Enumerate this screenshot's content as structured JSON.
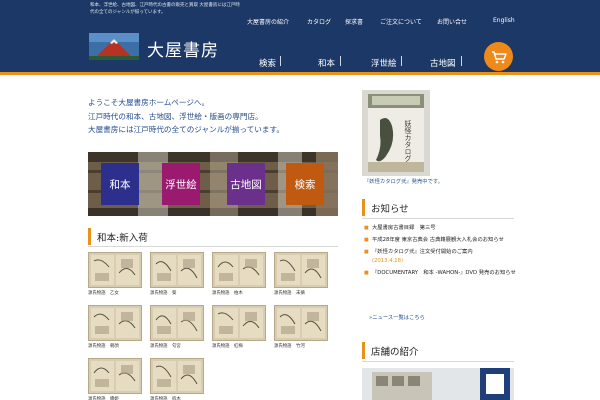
{
  "header": {
    "tagline": "和本、浮世絵、古地図、江戸時代の古書の販売と買取 大屋書房には江戸時代の全てのジャンルが揃っています。",
    "logo_text": "大屋書房",
    "top_nav": [
      "大屋書房の紹介",
      "カタログ",
      "探求書",
      "ご注文について",
      "お問い合せ",
      "English"
    ],
    "main_nav": [
      "検索",
      "和本",
      "浮世絵",
      "古地図"
    ],
    "cart_icon": "cart-icon"
  },
  "intro": {
    "lines": [
      "ようこそ大屋書房ホームページへ。",
      "江戸時代の和本、古地図、浮世絵・版画の専門店。",
      "大屋書房には江戸時代の全てのジャンルが揃っています。"
    ]
  },
  "categories": [
    {
      "label": "和本",
      "color": "#2c2f8c"
    },
    {
      "label": "浮世絵",
      "color": "#9a1a70"
    },
    {
      "label": "古地図",
      "color": "#6b2f8c"
    },
    {
      "label": "検索",
      "color": "#c05a10"
    }
  ],
  "new_arrivals": {
    "title": "和本:新入荷",
    "books": [
      {
        "caption": "源氏物語　乙女"
      },
      {
        "caption": "源氏物語　葵"
      },
      {
        "caption": "源氏物語　柏木"
      },
      {
        "caption": "源氏物語　末摘"
      },
      {
        "caption": "源氏物語　朝顔"
      },
      {
        "caption": "源氏物語　匂宮"
      },
      {
        "caption": "源氏物語　紅梅"
      },
      {
        "caption": "源氏物語　竹河"
      },
      {
        "caption": "源氏物語　橋姫"
      },
      {
        "caption": "源氏物語　宿木"
      }
    ]
  },
  "sidebar": {
    "catalog_caption": "『妖怪カタログ弐』発売中です。",
    "news_title": "お知らせ",
    "news": [
      {
        "text": "大屋書房古書目録　第三号",
        "date": ""
      },
      {
        "text": "平成28年度 東京古典会 古典籍展観大入札会のお知らせ",
        "date": ""
      },
      {
        "text": "『妖怪カタログ弐』注文受付開始のご案内",
        "date": "(2013.4.18)"
      },
      {
        "text": "『DOCUMENTARY　和本 -WAHON-』DVD 発売のお知らせ",
        "date": ""
      }
    ],
    "news_more": "»ニュース一覧はこちら",
    "store_title": "店舗の紹介"
  }
}
